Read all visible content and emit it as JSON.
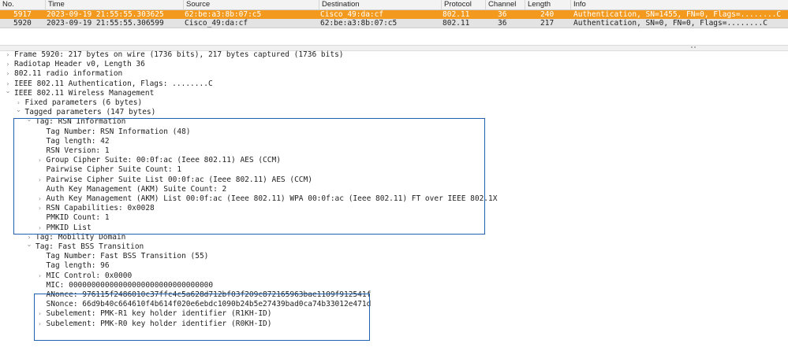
{
  "packet_list": {
    "columns": [
      "No.",
      "Time",
      "Source",
      "Destination",
      "Protocol",
      "Channel",
      "Length",
      "Info"
    ],
    "rows": [
      {
        "no": "5917",
        "time": "2023-09-19 21:55:55.303625",
        "source": "62:be:a3:8b:07:c5",
        "destination": "Cisco_49:da:cf",
        "protocol": "802.11",
        "channel": "36",
        "length": "240",
        "info": "Authentication, SN=1455, FN=0, Flags=........C",
        "selected": true
      },
      {
        "no": "5920",
        "time": "2023-09-19 21:55:55.306599",
        "source": "Cisco_49:da:cf",
        "destination": "62:be:a3:8b:07:c5",
        "protocol": "802.11",
        "channel": "36",
        "length": "217",
        "info": "Authentication, SN=0, FN=0, Flags=........C",
        "selected": false
      }
    ]
  },
  "details": {
    "lines": [
      {
        "text": "Frame 5920: 217 bytes on wire (1736 bits), 217 bytes captured (1736 bits)",
        "level": 0,
        "toggle": "collapsed"
      },
      {
        "text": "Radiotap Header v0, Length 36",
        "level": 0,
        "toggle": "collapsed"
      },
      {
        "text": "802.11 radio information",
        "level": 0,
        "toggle": "collapsed"
      },
      {
        "text": "IEEE 802.11 Authentication, Flags: ........C",
        "level": 0,
        "toggle": "collapsed"
      },
      {
        "text": "IEEE 802.11 Wireless Management",
        "level": 0,
        "toggle": "expanded"
      },
      {
        "text": "Fixed parameters (6 bytes)",
        "level": 1,
        "toggle": "collapsed"
      },
      {
        "text": "Tagged parameters (147 bytes)",
        "level": 1,
        "toggle": "expanded"
      },
      {
        "text": "Tag: RSN Information",
        "level": 2,
        "toggle": "expanded"
      },
      {
        "text": "Tag Number: RSN Information (48)",
        "level": 3,
        "toggle": "none"
      },
      {
        "text": "Tag length: 42",
        "level": 3,
        "toggle": "none"
      },
      {
        "text": "RSN Version: 1",
        "level": 3,
        "toggle": "none"
      },
      {
        "text": "Group Cipher Suite: 00:0f:ac (Ieee 802.11) AES (CCM)",
        "level": 3,
        "toggle": "collapsed"
      },
      {
        "text": "Pairwise Cipher Suite Count: 1",
        "level": 3,
        "toggle": "none"
      },
      {
        "text": "Pairwise Cipher Suite List 00:0f:ac (Ieee 802.11) AES (CCM)",
        "level": 3,
        "toggle": "collapsed"
      },
      {
        "text": "Auth Key Management (AKM) Suite Count: 2",
        "level": 3,
        "toggle": "none"
      },
      {
        "text": "Auth Key Management (AKM) List 00:0f:ac (Ieee 802.11) WPA 00:0f:ac (Ieee 802.11) FT over IEEE 802.1X",
        "level": 3,
        "toggle": "collapsed"
      },
      {
        "text": "RSN Capabilities: 0x0028",
        "level": 3,
        "toggle": "collapsed"
      },
      {
        "text": "PMKID Count: 1",
        "level": 3,
        "toggle": "none"
      },
      {
        "text": "PMKID List",
        "level": 3,
        "toggle": "collapsed"
      },
      {
        "text": "Tag: Mobility Domain",
        "level": 2,
        "toggle": "collapsed"
      },
      {
        "text": "Tag: Fast BSS Transition",
        "level": 2,
        "toggle": "expanded"
      },
      {
        "text": "Tag Number: Fast BSS Transition (55)",
        "level": 3,
        "toggle": "none"
      },
      {
        "text": "Tag length: 96",
        "level": 3,
        "toggle": "none"
      },
      {
        "text": "MIC Control: 0x0000",
        "level": 3,
        "toggle": "collapsed"
      },
      {
        "text": "MIC: 00000000000000000000000000000000",
        "level": 3,
        "toggle": "none"
      },
      {
        "text": "ANonce: 976115f2486010c37ffc4c5a628d712bf03f209c872165963bae1109f912541f",
        "level": 3,
        "toggle": "none"
      },
      {
        "text": "SNonce: 66d9b40c664610f4b614f020e6ebdc1090b24b5e27439bad0ca74b33012e471d",
        "level": 3,
        "toggle": "none"
      },
      {
        "text": "Subelement: PMK-R1 key holder identifier (R1KH-ID)",
        "level": 3,
        "toggle": "collapsed"
      },
      {
        "text": "Subelement: PMK-R0 key holder identifier (R0KH-ID)",
        "level": 3,
        "toggle": "collapsed"
      }
    ]
  },
  "icons": {
    "collapsed": "chevron-right-icon",
    "expanded": "chevron-down-icon"
  },
  "colors": {
    "selected_row": "#f39a1e",
    "highlight_box": "#1e62b0"
  }
}
